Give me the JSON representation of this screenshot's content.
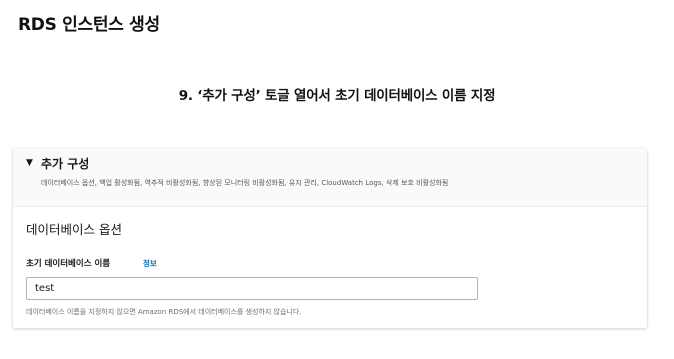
{
  "page": {
    "title": "RDS 인스턴스 생성",
    "step_heading": "9. ‘추가 구성’ 토글 열어서 초기 데이터베이스 이름 지정"
  },
  "additional_config": {
    "caret_icon": "caret-down-icon",
    "title": "추가 구성",
    "description": "데이터베이스 옵션, 백업 활성화됨, 역추적 비활성화됨, 향상된 모니터링 비활성화됨, 유지 관리, CloudWatch Logs, 삭제 보호 비활성화됨",
    "expanded": true
  },
  "database_options": {
    "section_title": "데이터베이스 옵션",
    "initial_db_name_label": "초기 데이터베이스 이름",
    "info_link": "정보",
    "initial_db_name_value": "test",
    "hint": "데이터베이스 이름을 지정하지 않으면 Amazon RDS에서 데이터베이스를 생성하지 않습니다."
  },
  "colors": {
    "link": "#0073bb",
    "input_border": "#aab7b8",
    "header_bg": "#fafafa"
  }
}
